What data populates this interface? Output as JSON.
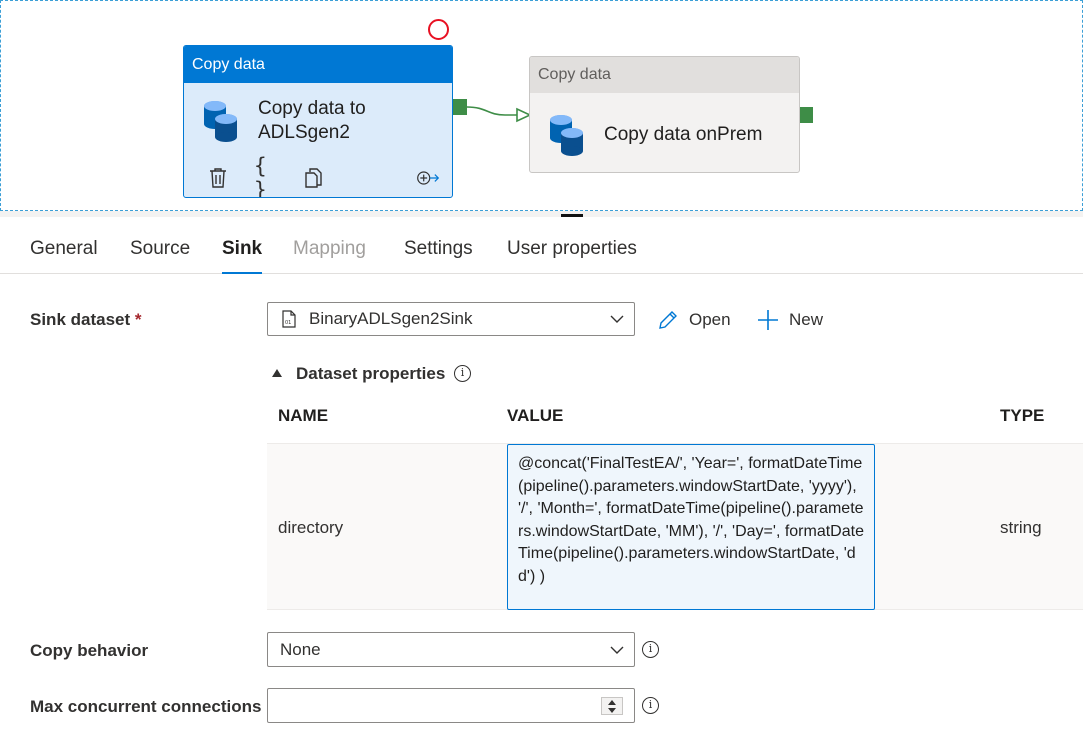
{
  "pipeline": {
    "activities": [
      {
        "header": "Copy data",
        "name": "Copy data to ADLSgen2",
        "selected": true
      },
      {
        "header": "Copy data",
        "name": "Copy data onPrem",
        "selected": false
      }
    ],
    "connector_color": "#3e8d47"
  },
  "tabs": [
    {
      "label": "General",
      "state": "normal"
    },
    {
      "label": "Source",
      "state": "normal"
    },
    {
      "label": "Sink",
      "state": "active"
    },
    {
      "label": "Mapping",
      "state": "disabled"
    },
    {
      "label": "Settings",
      "state": "normal"
    },
    {
      "label": "User properties",
      "state": "normal"
    }
  ],
  "sink": {
    "dataset_label": "Sink dataset",
    "required_mark": "*",
    "dataset_value": "BinaryADLSgen2Sink",
    "open_label": "Open",
    "new_label": "New",
    "dataset_properties_label": "Dataset properties",
    "table": {
      "headers": {
        "name": "NAME",
        "value": "VALUE",
        "type": "TYPE"
      },
      "rows": [
        {
          "name": "directory",
          "value": "@concat('FinalTestEA/', 'Year=', formatDateTime(pipeline().parameters.windowStartDate, 'yyyy'), '/', 'Month=', formatDateTime(pipeline().parameters.windowStartDate, 'MM'), '/', 'Day=', formatDateTime(pipeline().parameters.windowStartDate, 'dd') )",
          "type": "string"
        }
      ]
    },
    "copy_behavior_label": "Copy behavior",
    "copy_behavior_value": "None",
    "max_connections_label": "Max concurrent connections",
    "max_connections_value": ""
  },
  "colors": {
    "accent": "#0078d4",
    "selected_bg": "#dcebfa",
    "required": "#a4262c",
    "error_ring": "#e81123"
  }
}
